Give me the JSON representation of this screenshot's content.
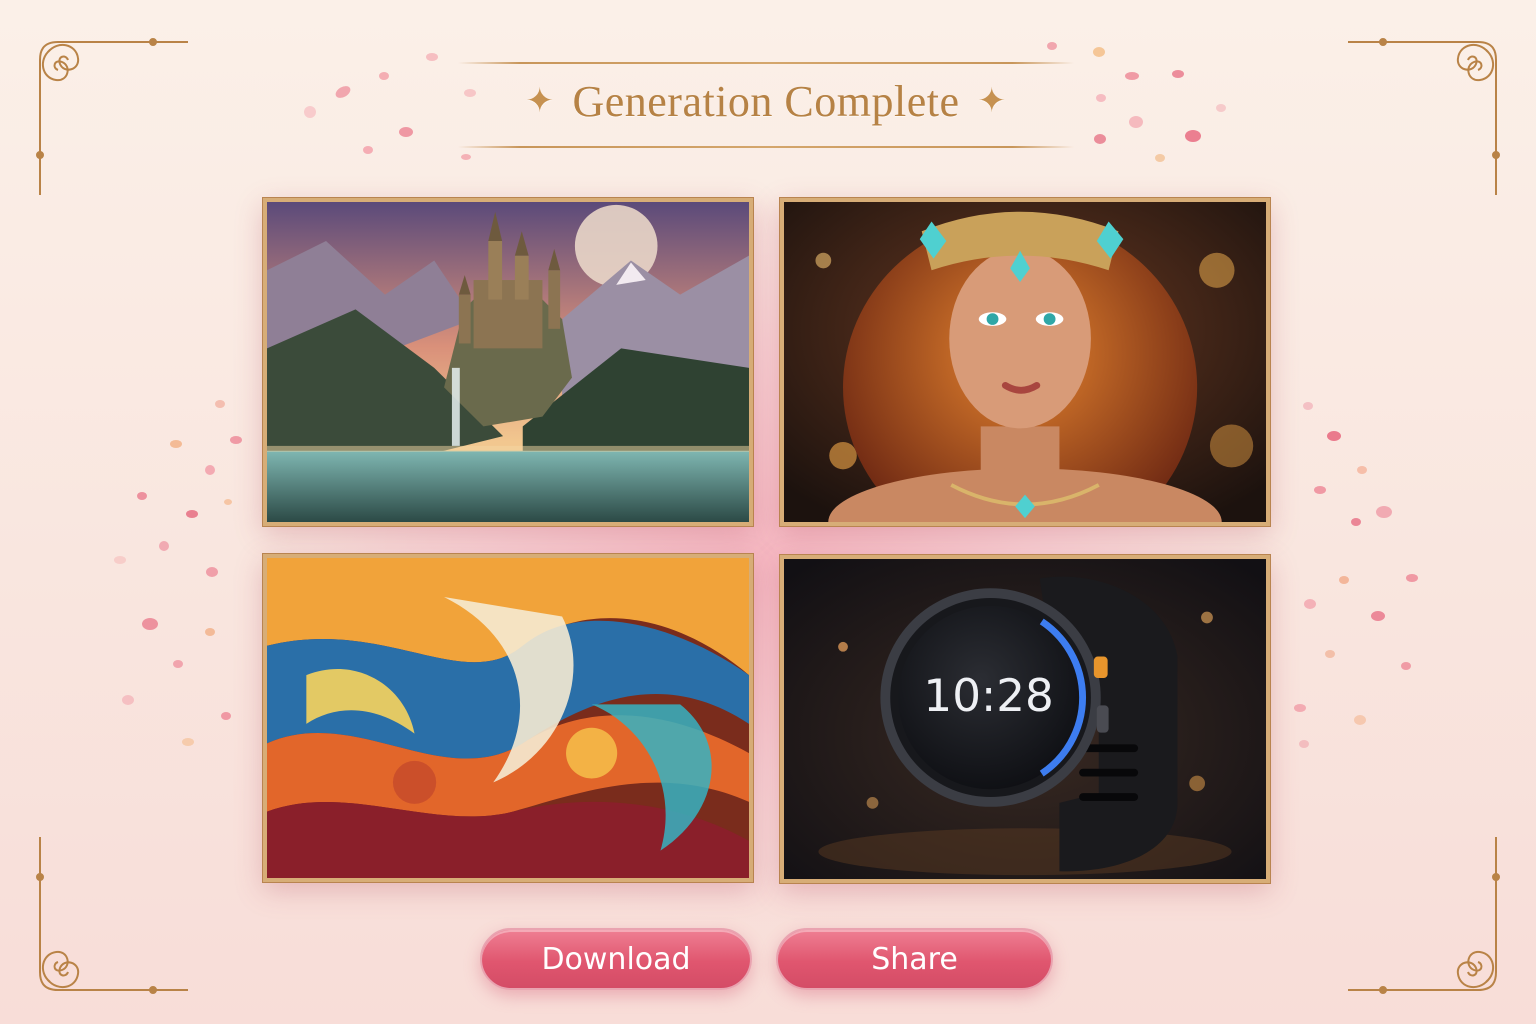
{
  "header": {
    "title": "Generation Complete",
    "left_ornament": "✦",
    "right_ornament": "✦"
  },
  "gallery": {
    "images": [
      {
        "subject": "fantasy castle on a mountain with waterfall and moon"
      },
      {
        "subject": "portrait of a woman with red hair and jeweled crown"
      },
      {
        "subject": "abstract colorful swirling waves"
      },
      {
        "subject": "black smartwatch",
        "watch_time": "10:28"
      }
    ]
  },
  "actions": {
    "download_label": "Download",
    "share_label": "Share"
  },
  "colors": {
    "accent_gold": "#b68245",
    "button_pink": "#e0566f",
    "background": "#fbf0e8"
  }
}
